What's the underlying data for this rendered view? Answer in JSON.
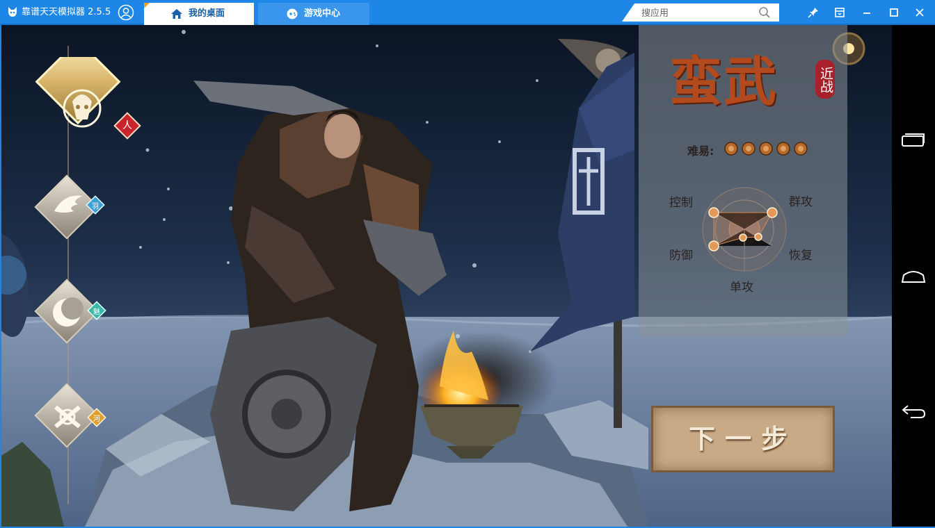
{
  "window": {
    "app_title": "靠谱天天模拟器 2.5.5",
    "accent_color": "#1d86e6"
  },
  "tabs": [
    {
      "label": "我的桌面",
      "icon": "home-icon",
      "active": true
    },
    {
      "label": "游戏中心",
      "icon": "game-controller-icon",
      "active": false
    }
  ],
  "search": {
    "placeholder": "搜应用",
    "value": ""
  },
  "window_controls": [
    "pin-icon",
    "minimize-to-tray-icon",
    "minimize-icon",
    "maximize-icon",
    "close-icon"
  ],
  "android_nav": [
    "recent-apps-icon",
    "home-icon",
    "back-icon"
  ],
  "game": {
    "classes": [
      {
        "badge": "人",
        "icon": "bull-skull-emblem-icon",
        "selected": true,
        "badge_color": "#c8242c"
      },
      {
        "badge": "羽",
        "icon": "wing-emblem-icon",
        "selected": false,
        "badge_color": "#3aa0d8"
      },
      {
        "badge": "魅",
        "icon": "crescent-emblem-icon",
        "selected": false,
        "badge_color": "#3ab8a8"
      },
      {
        "badge": "河",
        "icon": "crossed-guns-emblem-icon",
        "selected": false,
        "badge_color": "#e0a030"
      }
    ],
    "class_info": {
      "name": "蛮武",
      "tag": "近战",
      "difficulty_label": "难易:",
      "difficulty": 5,
      "difficulty_max": 5,
      "radar_labels": {
        "top_left": "控制",
        "top_right": "群攻",
        "left": "防御",
        "right": "恢复",
        "bottom": "单攻"
      }
    },
    "next_button": "下一步"
  }
}
